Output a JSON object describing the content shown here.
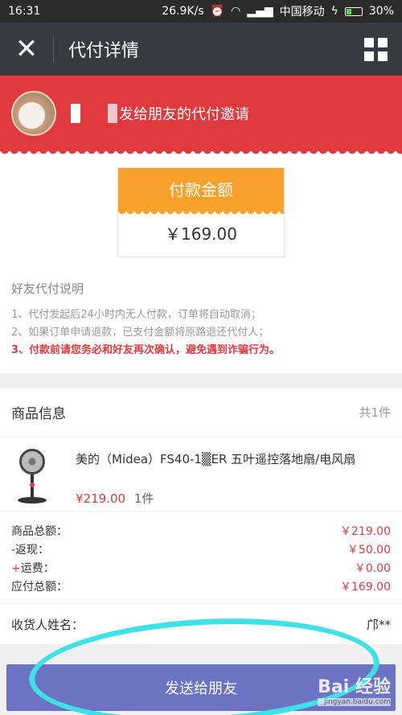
{
  "status_bar": {
    "time": "16:31",
    "speed": "26.9K/s",
    "carrier": "中国移动",
    "battery": "30%"
  },
  "nav": {
    "title": "代付详情"
  },
  "banner": {
    "text": "发给朋友的代付邀请"
  },
  "payment": {
    "label": "付款金额",
    "amount": "￥169.00"
  },
  "explanation": {
    "title": "好友代付说明",
    "line1": "1、代付发起后24小时内无人付款，订单将自动取消；",
    "line2": "2、如果订单申请退款，已支付金额将原路退还代付人；",
    "line3": "3、付款前请您务必和好友再次确认，避免遇到诈骗行为。"
  },
  "product_section": {
    "title": "商品信息",
    "count": "共1件",
    "product": {
      "name": "美的（Midea）FS40-1▒ER 五叶遥控落地扇/电风扇",
      "price": "¥219.00",
      "qty": "1件"
    }
  },
  "summary": {
    "goods_total_label": "商品总额：",
    "goods_total_value": "￥219.00",
    "rebate_label": "-返现：",
    "rebate_value": "￥50.00",
    "shipping_label": "运费：",
    "shipping_prefix": "+",
    "shipping_value": "￥0.00",
    "payable_label": "应付总额：",
    "payable_value": "￥169.00"
  },
  "receiver": {
    "label": "收货人姓名：",
    "value": "邝**"
  },
  "send_button": "发送给朋友",
  "watermark": {
    "logo": "Bai  经验",
    "url": "jingyan.baidu.com"
  },
  "colors": {
    "banner_red": "#e0393e",
    "pay_orange": "#f9a12a",
    "button_purple": "#6b73c2",
    "annotation_cyan": "#3fe0e6"
  }
}
